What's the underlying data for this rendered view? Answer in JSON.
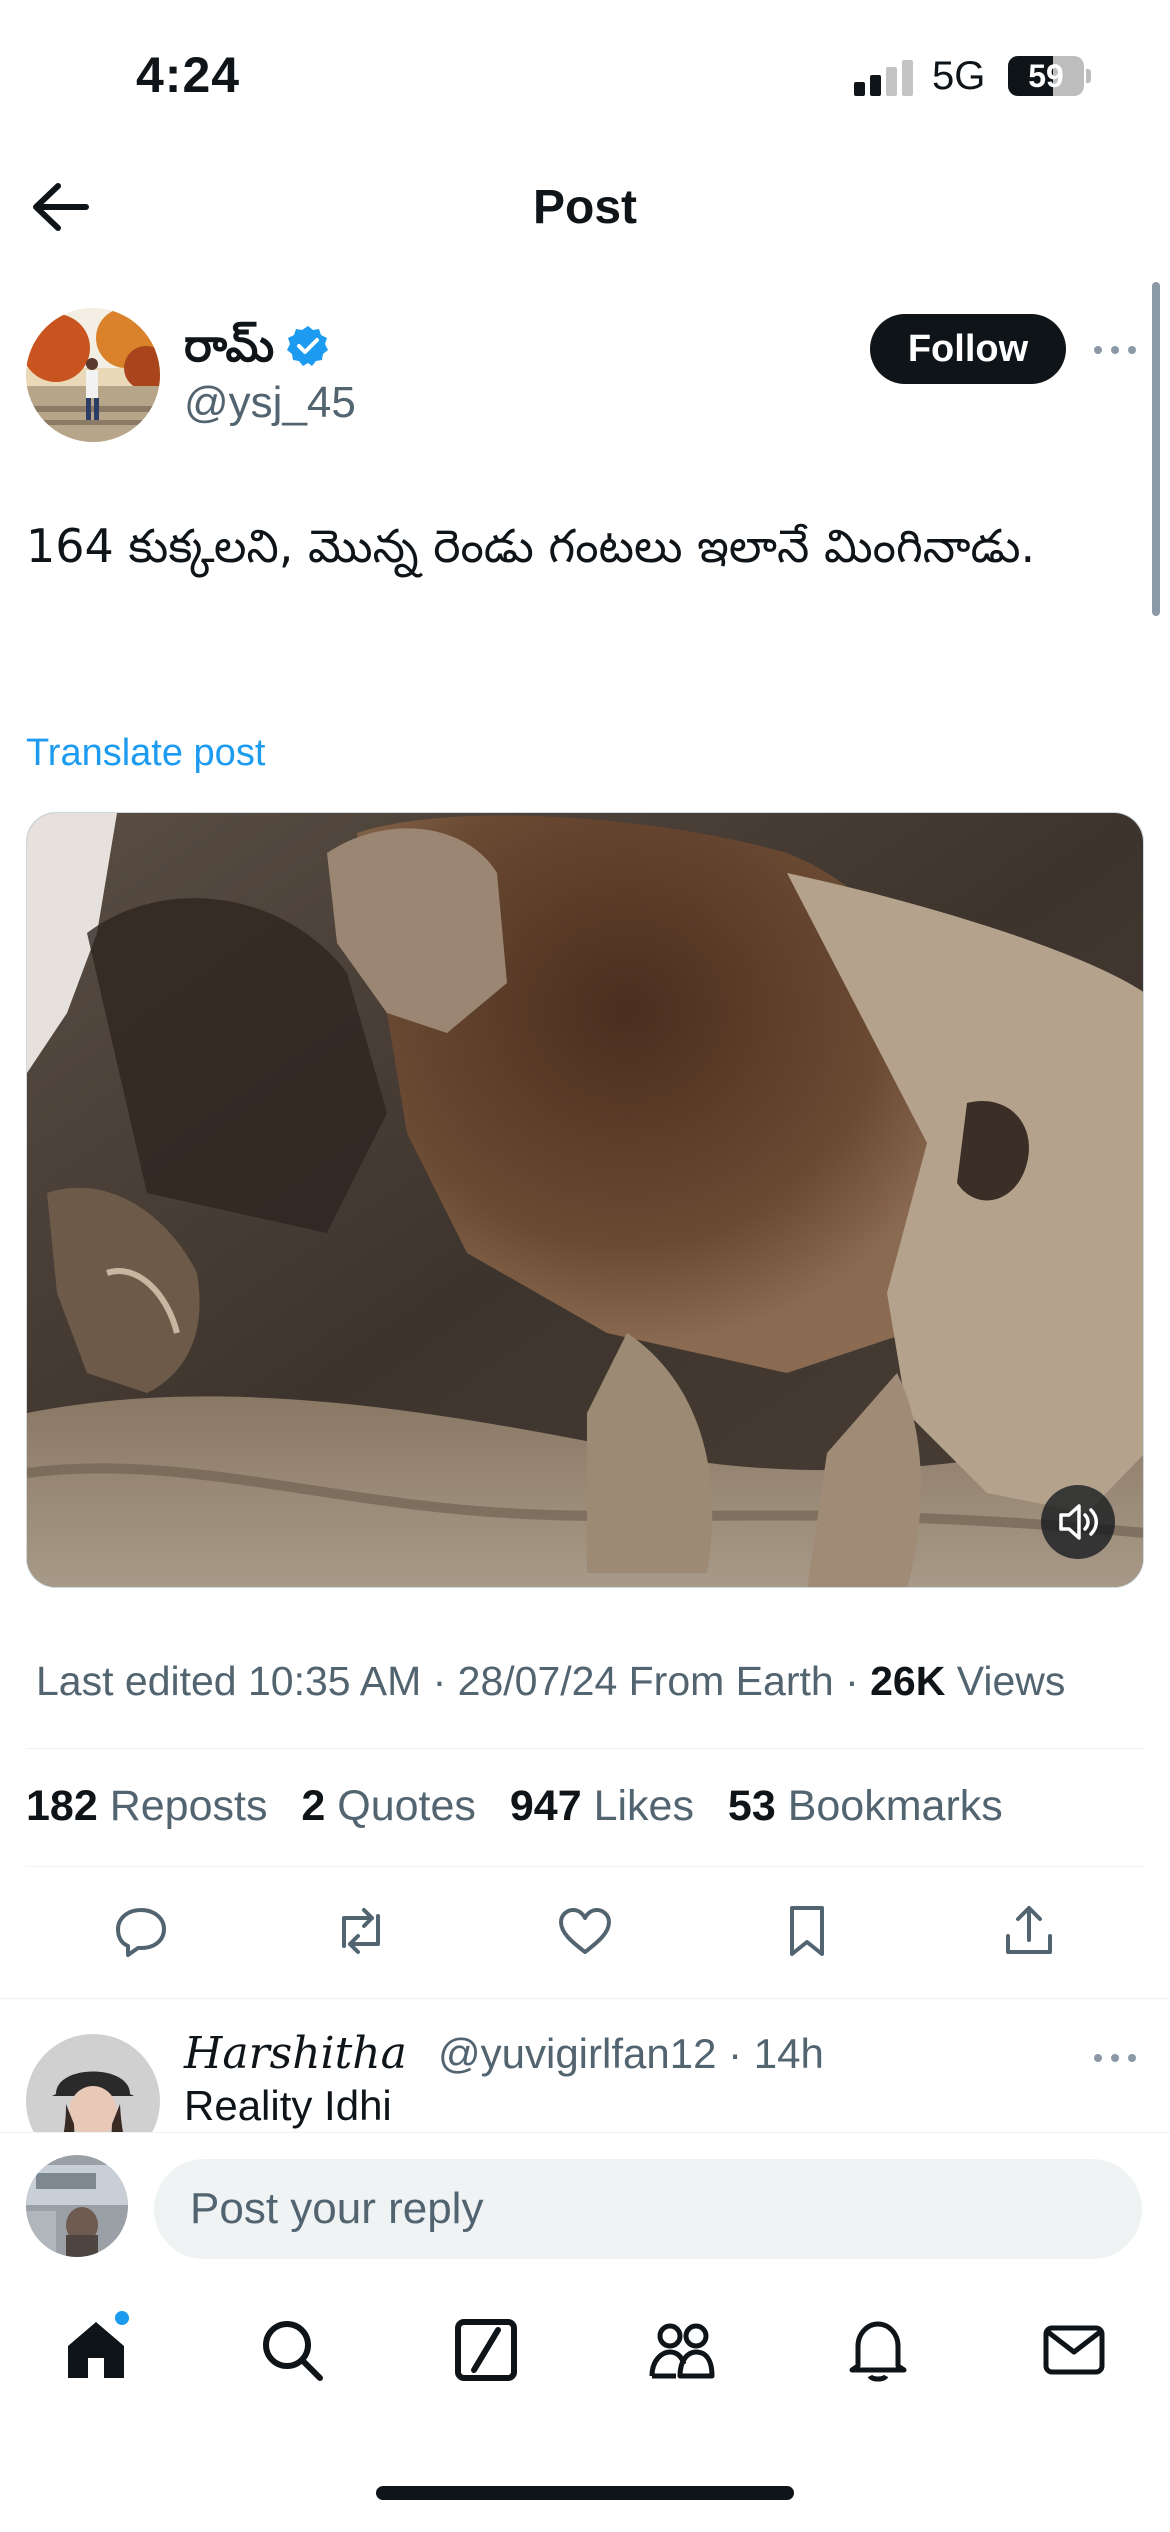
{
  "status_bar": {
    "time": "4:24",
    "network": "5G",
    "battery": "59",
    "battery_level": 0.59
  },
  "header": {
    "title": "Post",
    "back_icon": "arrow-left-icon"
  },
  "author": {
    "display_name": "రామ్",
    "handle": "@ysj_45",
    "verified": true,
    "follow_label": "Follow"
  },
  "post": {
    "text": "164 కుక్కలని, మొన్న  రెండు గంటలు ఇలానే మింగినాడు.",
    "translate_label": "Translate post",
    "media": {
      "type": "video",
      "description_icon": "volume-icon"
    }
  },
  "meta": {
    "edited": "Last edited 10:35 AM · 28/07/24  From Earth · ",
    "views_count": "26K",
    "views_label": " Views"
  },
  "stats": [
    {
      "count": "182",
      "label": " Reposts"
    },
    {
      "count": "2",
      "label": " Quotes"
    },
    {
      "count": "947",
      "label": " Likes"
    },
    {
      "count": "53",
      "label": " Bookmarks"
    }
  ],
  "actions": [
    "reply-icon",
    "repost-icon",
    "like-icon",
    "bookmark-icon",
    "share-icon"
  ],
  "reply": {
    "name": "Harshitha",
    "handle_time": "@yuvigirlfan12 · 14h",
    "text": "Reality Idhi"
  },
  "compose": {
    "placeholder": "Post your reply"
  },
  "tabs": [
    "home-icon",
    "search-icon",
    "grok-icon",
    "communities-icon",
    "notifications-icon",
    "messages-icon"
  ],
  "colors": {
    "accent": "#1d9bf0",
    "text": "#0f1419",
    "secondary": "#536471"
  }
}
